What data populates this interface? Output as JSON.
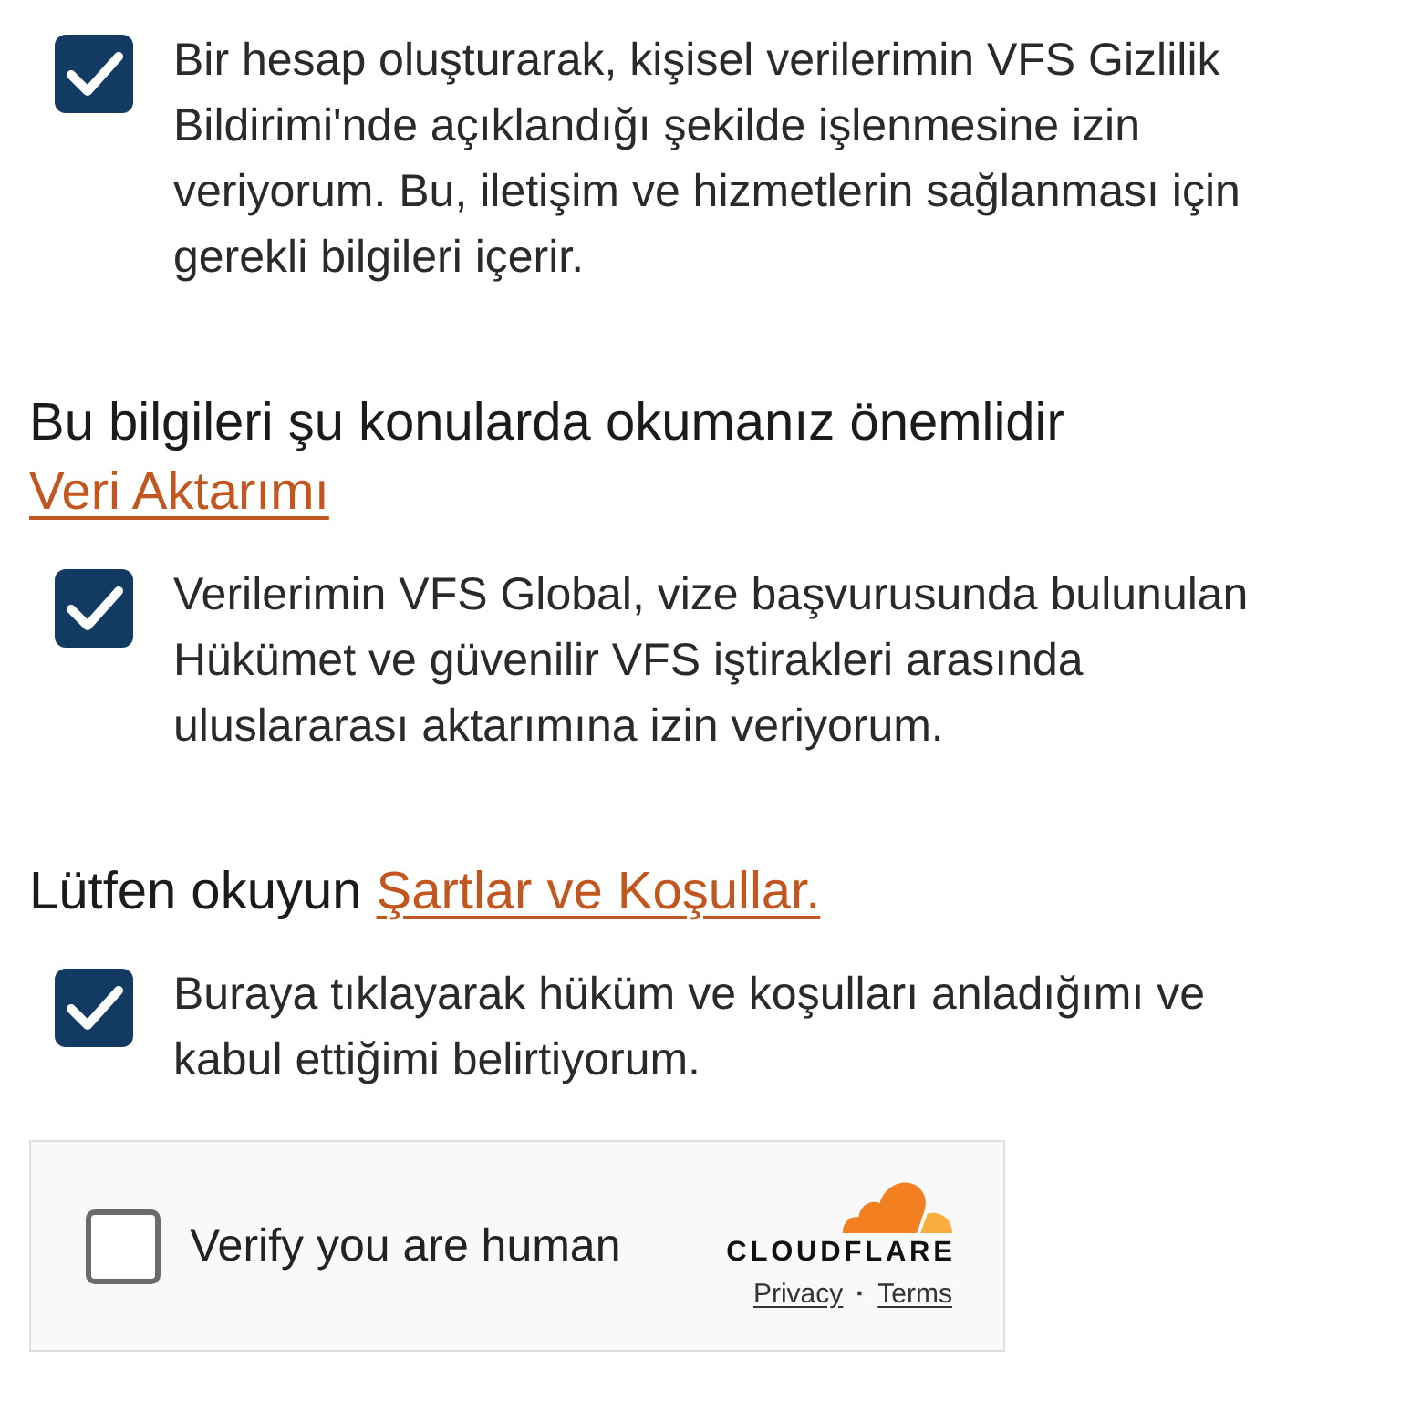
{
  "blocks": [
    {
      "kind": "consent",
      "checked": true,
      "text": "Bir hesap oluşturarak, kişisel verilerimin VFS Gizlilik Bildirimi'nde açıklandığı şekilde işlenmesine izin veriyorum. Bu, iletişim ve hizmetlerin sağlanması için gerekli bilgileri içerir."
    },
    {
      "kind": "notice",
      "text": "Bu bilgileri şu konularda okumanız önemlidir",
      "link": "Veri Aktarımı"
    },
    {
      "kind": "consent",
      "checked": true,
      "text": "Verilerimin VFS Global, vize başvurusunda bulunulan Hükümet ve güvenilir VFS iştirakleri arasında uluslararası aktarımına izin veriyorum."
    },
    {
      "kind": "notice",
      "text": "Lütfen okuyun",
      "link": "Şartlar ve Koşullar."
    },
    {
      "kind": "consent",
      "checked": true,
      "text": "Buraya tıklayarak hüküm ve koşulları anladığımı ve kabul ettiğimi belirtiyorum."
    }
  ],
  "captcha": {
    "checked": false,
    "label": "Verify you are human",
    "brand": "CLOUDFLARE",
    "links": [
      "Privacy",
      "Terms"
    ],
    "separator": "·"
  }
}
